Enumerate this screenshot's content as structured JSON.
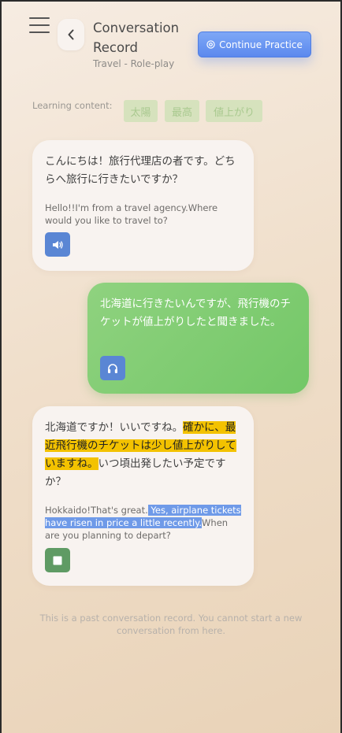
{
  "header": {
    "title": "Conversation Record",
    "subtitle": "Travel - Role-play",
    "continue_label": "Continue Practice"
  },
  "learning": {
    "label": "Learning content:",
    "chips": [
      "太陽",
      "最高",
      "値上がり"
    ]
  },
  "messages": [
    {
      "role": "agent",
      "jp": "こんにちは！旅行代理店の者です。どちらへ旅行に行きたいですか？",
      "en": "Hello!!I'm from a travel agency.Where would you like to travel to?",
      "button_icon": "speaker-icon"
    },
    {
      "role": "user",
      "jp": "北海道に行きたいんですが、飛行機のチケットが値上がりしたと聞きました。",
      "button_icon": "headphones-icon"
    },
    {
      "role": "agent",
      "jp_before": "北海道ですか！いいですね。",
      "jp_highlight": "確かに、最近飛行機のチケットは少し値上がりしていますね。",
      "jp_after": "いつ頃出発したい予定ですか？",
      "en_before": "Hokkaido!That's great.",
      "en_highlight": " Yes, airplane tickets have risen in price a little recently.",
      "en_after": "When are you planning to depart?",
      "button_icon": "stop-icon"
    }
  ],
  "footer": "This is a past conversation record. You cannot start a new conversation from here.",
  "colors": {
    "accent_blue": "#5b89ee",
    "user_bubble": "#7fcb70",
    "highlight_jp": "#f3c200",
    "highlight_en": "#6f9ae8",
    "speaker_button": "#5a86d4",
    "headphone_button": "#5a86d4",
    "stop_button": "#5f9b64"
  }
}
